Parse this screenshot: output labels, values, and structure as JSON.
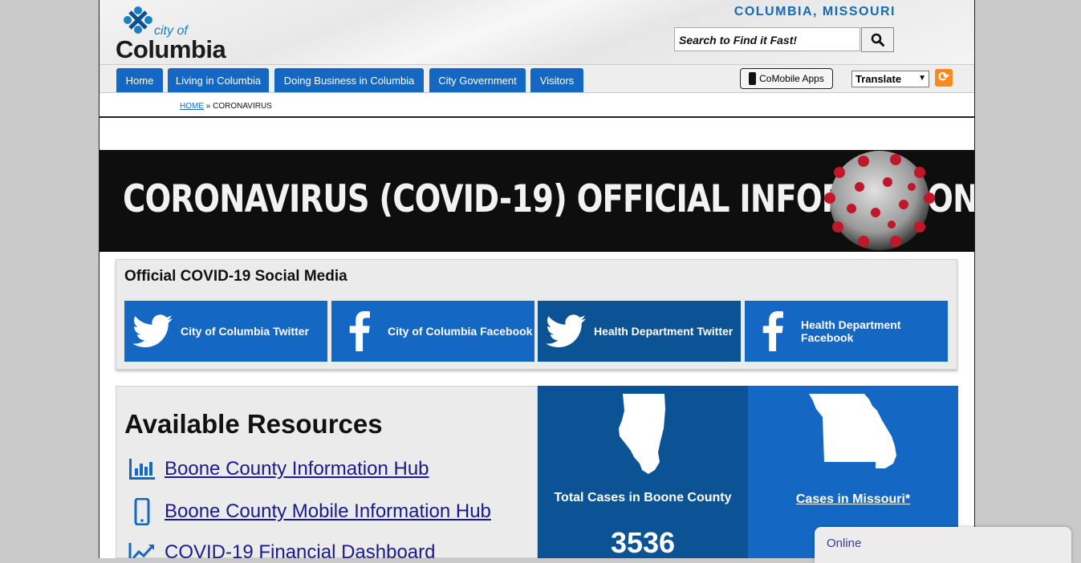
{
  "header": {
    "logo_city_of": "city of",
    "logo_columbia": "Columbia",
    "place": "COLUMBIA, MISSOURI",
    "search_placeholder": "Search to Find it Fast!"
  },
  "nav": {
    "tabs": [
      "Home",
      "Living in Columbia",
      "Doing Business in Columbia",
      "City Government",
      "Visitors"
    ],
    "apps_label": "CoMobile Apps",
    "translate_label": "Translate"
  },
  "breadcrumb": {
    "home": "HOME",
    "separator": "»",
    "current": "CORONAVIRUS"
  },
  "banner": {
    "title": "CORONAVIRUS (COVID-19) OFFICIAL INFORMATION"
  },
  "social": {
    "heading": "Official COVID-19 Social Media",
    "buttons": [
      {
        "label": "City of Columbia Twitter",
        "icon": "twitter-icon",
        "color": "#1468c4"
      },
      {
        "label": "City of Columbia Facebook",
        "icon": "facebook-icon",
        "color": "#1468c4"
      },
      {
        "label": "Health Department Twitter",
        "icon": "twitter-icon",
        "color": "#0b5394"
      },
      {
        "label": "Health Department Facebook",
        "icon": "facebook-icon",
        "color": "#1468c4"
      }
    ]
  },
  "resources": {
    "heading": "Available Resources",
    "links": [
      {
        "label": "Boone County Information Hub",
        "icon": "bar-chart-icon"
      },
      {
        "label": "Boone County Mobile Information Hub",
        "icon": "mobile-phone-icon"
      },
      {
        "label": "COVID-19 Financial Dashboard",
        "icon": "trend-chart-icon"
      }
    ]
  },
  "stats": {
    "boone_label": "Total Cases in Boone County",
    "boone_value": "3536",
    "missouri_label": "Cases in Missouri*"
  },
  "chat": {
    "status": "Online"
  },
  "colors": {
    "primary_blue": "#1468c4",
    "dark_blue": "#0b5394",
    "place_blue": "#1769b0",
    "banner_bg": "#0e0e0e"
  }
}
